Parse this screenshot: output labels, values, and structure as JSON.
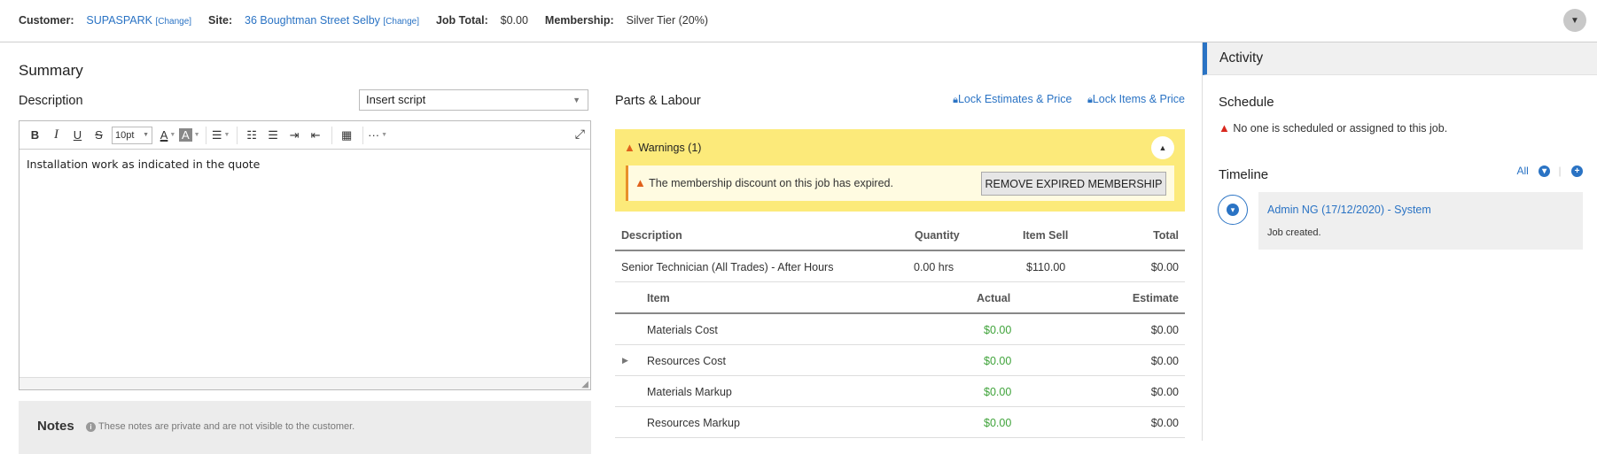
{
  "header": {
    "customer_label": "Customer:",
    "customer_value": "SUPASPARK",
    "customer_change": "[Change]",
    "site_label": "Site:",
    "site_value": "36 Boughtman Street Selby",
    "site_change": "[Change]",
    "job_total_label": "Job Total:",
    "job_total_value": "$0.00",
    "membership_label": "Membership:",
    "membership_value": "Silver Tier (20%)",
    "collapse_icon": "▼"
  },
  "summary": {
    "title": "Summary",
    "description_label": "Description",
    "script_select": "Insert script",
    "editor": {
      "font_size": "10pt",
      "content": "Installation work as indicated in the quote"
    },
    "notes": {
      "title": "Notes",
      "hint": "These notes are private and are not visible to the customer."
    }
  },
  "parts_labour": {
    "title": "Parts & Labour",
    "lock_estimates": "Lock Estimates & Price",
    "lock_items": "Lock Items & Price",
    "warnings": {
      "header": "Warnings (1)",
      "message": "The membership discount on this job has expired.",
      "button": "REMOVE EXPIRED MEMBERSHIP"
    },
    "table": {
      "headers": {
        "description": "Description",
        "quantity": "Quantity",
        "item_sell": "Item Sell",
        "total": "Total"
      },
      "line": {
        "description": "Senior Technician (All Trades) - After Hours",
        "quantity": "0.00 hrs",
        "item_sell": "$110.00",
        "total": "$0.00"
      },
      "sub_headers": {
        "item": "Item",
        "actual": "Actual",
        "estimate": "Estimate"
      },
      "sub_rows": [
        {
          "item": "Materials Cost",
          "actual": "$0.00",
          "estimate": "$0.00"
        },
        {
          "item": "Resources Cost",
          "actual": "$0.00",
          "estimate": "$0.00"
        },
        {
          "item": "Materials Markup",
          "actual": "$0.00",
          "estimate": "$0.00"
        },
        {
          "item": "Resources Markup",
          "actual": "$0.00",
          "estimate": "$0.00"
        }
      ]
    }
  },
  "activity": {
    "title": "Activity",
    "schedule_title": "Schedule",
    "schedule_message": "No one is scheduled or assigned to this job.",
    "timeline_title": "Timeline",
    "timeline_filter": "All",
    "timeline_entry": {
      "who": "Admin NG (17/12/2020) - System",
      "what": "Job created."
    }
  },
  "colors": {
    "accent": "#2a73c4",
    "warning_bg": "#fcea7a",
    "positive": "#3fa33a"
  }
}
